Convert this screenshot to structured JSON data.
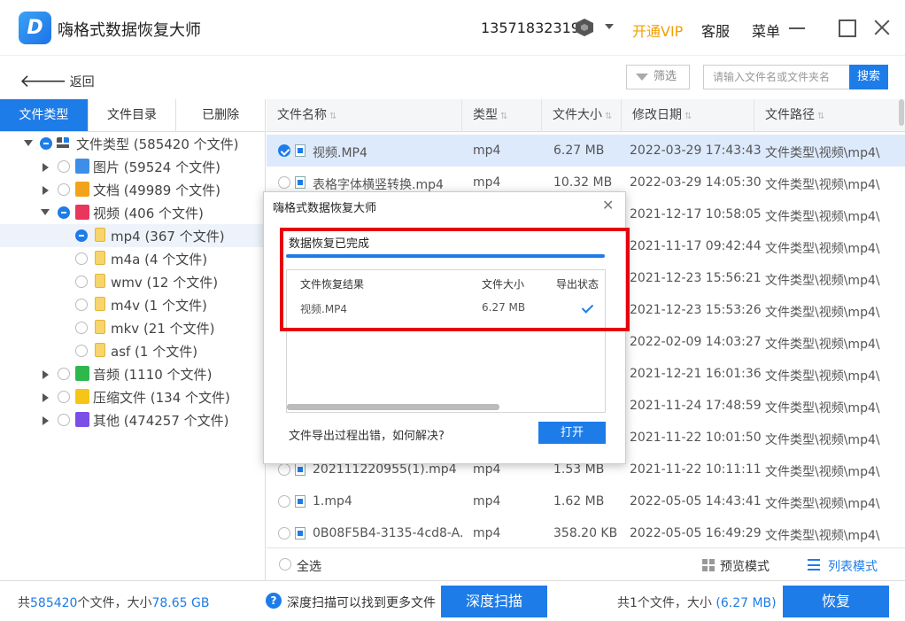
{
  "app": {
    "title": "嗨格式数据恢复大师",
    "phone": "13571832319",
    "vip": "开通VIP",
    "kefu": "客服",
    "menu": "菜单"
  },
  "toolbar": {
    "back": "返回",
    "filter": "筛选",
    "search_placeholder": "请输入文件名或文件夹名",
    "search_btn": "搜索"
  },
  "tabs": [
    "文件类型",
    "文件目录",
    "已删除"
  ],
  "tree": [
    {
      "label": "文件类型 (585420 个文件)",
      "icon_color": "#555"
    },
    {
      "label": "图片 (59524 个文件)",
      "icon_color": "#3d8ee8"
    },
    {
      "label": "文档 (49989 个文件)",
      "icon_color": "#f3a31b"
    },
    {
      "label": "视频 (406 个文件)",
      "icon_color": "#e8365d"
    },
    {
      "label": "mp4 (367 个文件)"
    },
    {
      "label": "m4a (4 个文件)"
    },
    {
      "label": "wmv (12 个文件)"
    },
    {
      "label": "m4v (1 个文件)"
    },
    {
      "label": "mkv (21 个文件)"
    },
    {
      "label": "asf (1 个文件)"
    },
    {
      "label": "音频 (1110 个文件)",
      "icon_color": "#2db84d"
    },
    {
      "label": "压缩文件 (134 个文件)",
      "icon_color": "#f5c518"
    },
    {
      "label": "其他 (474257 个文件)",
      "icon_color": "#7b4ee8"
    }
  ],
  "columns": [
    "文件名称",
    "类型",
    "文件大小",
    "修改日期",
    "文件路径"
  ],
  "rows": [
    {
      "name": "视频.MP4",
      "type": "mp4",
      "size": "6.27 MB",
      "date": "2022-03-29 17:43:43",
      "path": "文件类型\\视频\\mp4\\"
    },
    {
      "name": "表格字体横竖转换.mp4",
      "type": "mp4",
      "size": "10.32 MB",
      "date": "2022-03-29 14:05:30",
      "path": "文件类型\\视频\\mp4\\"
    },
    {
      "name": "",
      "type": "",
      "size": "",
      "date": "2021-12-17 10:58:05",
      "path": "文件类型\\视频\\mp4\\"
    },
    {
      "name": "",
      "type": "",
      "size": "",
      "date": "2021-11-17 09:42:44",
      "path": "文件类型\\视频\\mp4\\"
    },
    {
      "name": "",
      "type": "",
      "size": "",
      "date": "2021-12-23 15:56:21",
      "path": "文件类型\\视频\\mp4\\"
    },
    {
      "name": "",
      "type": "",
      "size": "",
      "date": "2021-12-23 15:53:26",
      "path": "文件类型\\视频\\mp4\\"
    },
    {
      "name": "",
      "type": "",
      "size": "",
      "date": "2022-02-09 14:03:27",
      "path": "文件类型\\视频\\mp4\\"
    },
    {
      "name": "",
      "type": "",
      "size": "",
      "date": "2021-12-21 16:01:36",
      "path": "文件类型\\视频\\mp4\\"
    },
    {
      "name": "",
      "type": "",
      "size": "",
      "date": "2021-11-24 17:48:59",
      "path": "文件类型\\视频\\mp4\\"
    },
    {
      "name": "",
      "type": "",
      "size": "",
      "date": "2021-11-22 10:01:50",
      "path": "文件类型\\视频\\mp4\\"
    },
    {
      "name": "202111220955(1).mp4",
      "type": "mp4",
      "size": "1.53 MB",
      "date": "2021-11-22 10:11:11",
      "path": "文件类型\\视频\\mp4\\"
    },
    {
      "name": "1.mp4",
      "type": "mp4",
      "size": "1.62 MB",
      "date": "2022-05-05 14:43:41",
      "path": "文件类型\\视频\\mp4\\"
    },
    {
      "name": "0B08F5B4-3135-4cd8-A...",
      "type": "mp4",
      "size": "358.20 KB",
      "date": "2022-05-05 16:49:29",
      "path": "文件类型\\视频\\mp4\\"
    }
  ],
  "table_footer": {
    "select_all": "全选",
    "preview_mode": "预览模式",
    "list_mode": "列表模式"
  },
  "bottom": {
    "total_prefix": "共",
    "total_count": "585420",
    "total_mid": "个文件，大小",
    "total_size": "78.65 GB",
    "deep_hint": "深度扫描可以找到更多文件",
    "deep_btn": "深度扫描",
    "sel_prefix": "共1个文件，大小",
    "sel_size": "(6.27 MB)",
    "recover_btn": "恢复"
  },
  "dialog": {
    "title": "嗨格式数据恢复大师",
    "close": "✕",
    "status": "数据恢复已完成",
    "progress": 1.0,
    "result_headers": [
      "文件恢复结果",
      "文件大小",
      "导出状态"
    ],
    "result_row": {
      "name": "视频.MP4",
      "size": "6.27 MB"
    },
    "help": "文件导出过程出错，如何解决?",
    "open_btn": "打开"
  },
  "colors": {
    "accent": "#1e7ce8",
    "vip": "#f0a000",
    "highlight_box": "#e60012"
  }
}
